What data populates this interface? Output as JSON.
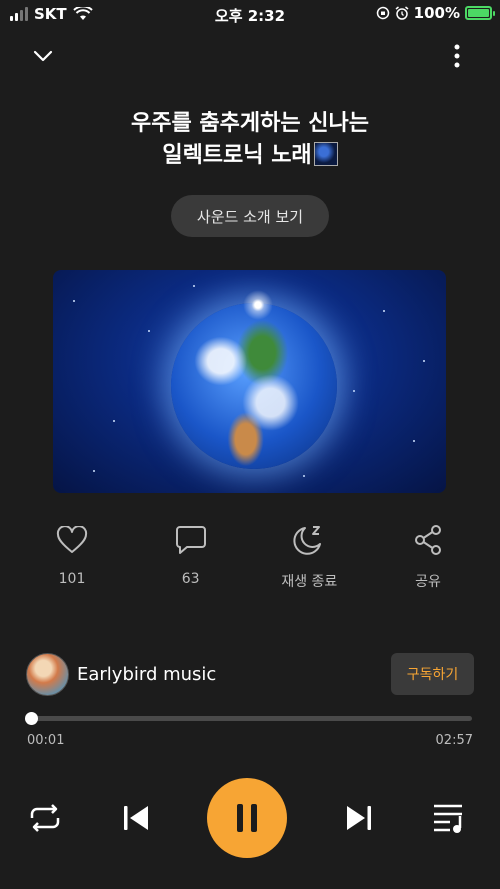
{
  "status_bar": {
    "carrier": "SKT",
    "time": "오후 2:32",
    "battery": "100%"
  },
  "track": {
    "title_line1": "우주를 춤추게하는 신나는",
    "title_line2": "일렉트로닉 노래",
    "intro_button": "사운드 소개 보기"
  },
  "actions": [
    {
      "name": "like",
      "icon": "heart-icon",
      "label": "101"
    },
    {
      "name": "comment",
      "icon": "comment-icon",
      "label": "63"
    },
    {
      "name": "sleep-timer",
      "icon": "moon-icon",
      "label": "재생 종료"
    },
    {
      "name": "share",
      "icon": "share-icon",
      "label": "공유"
    }
  ],
  "channel": {
    "name": "Earlybird music",
    "subscribe_label": "구독하기"
  },
  "playback": {
    "current_time": "00:01",
    "total_time": "02:57",
    "progress": 0.006
  },
  "colors": {
    "accent": "#f7a534",
    "background": "#1c1c1c"
  }
}
